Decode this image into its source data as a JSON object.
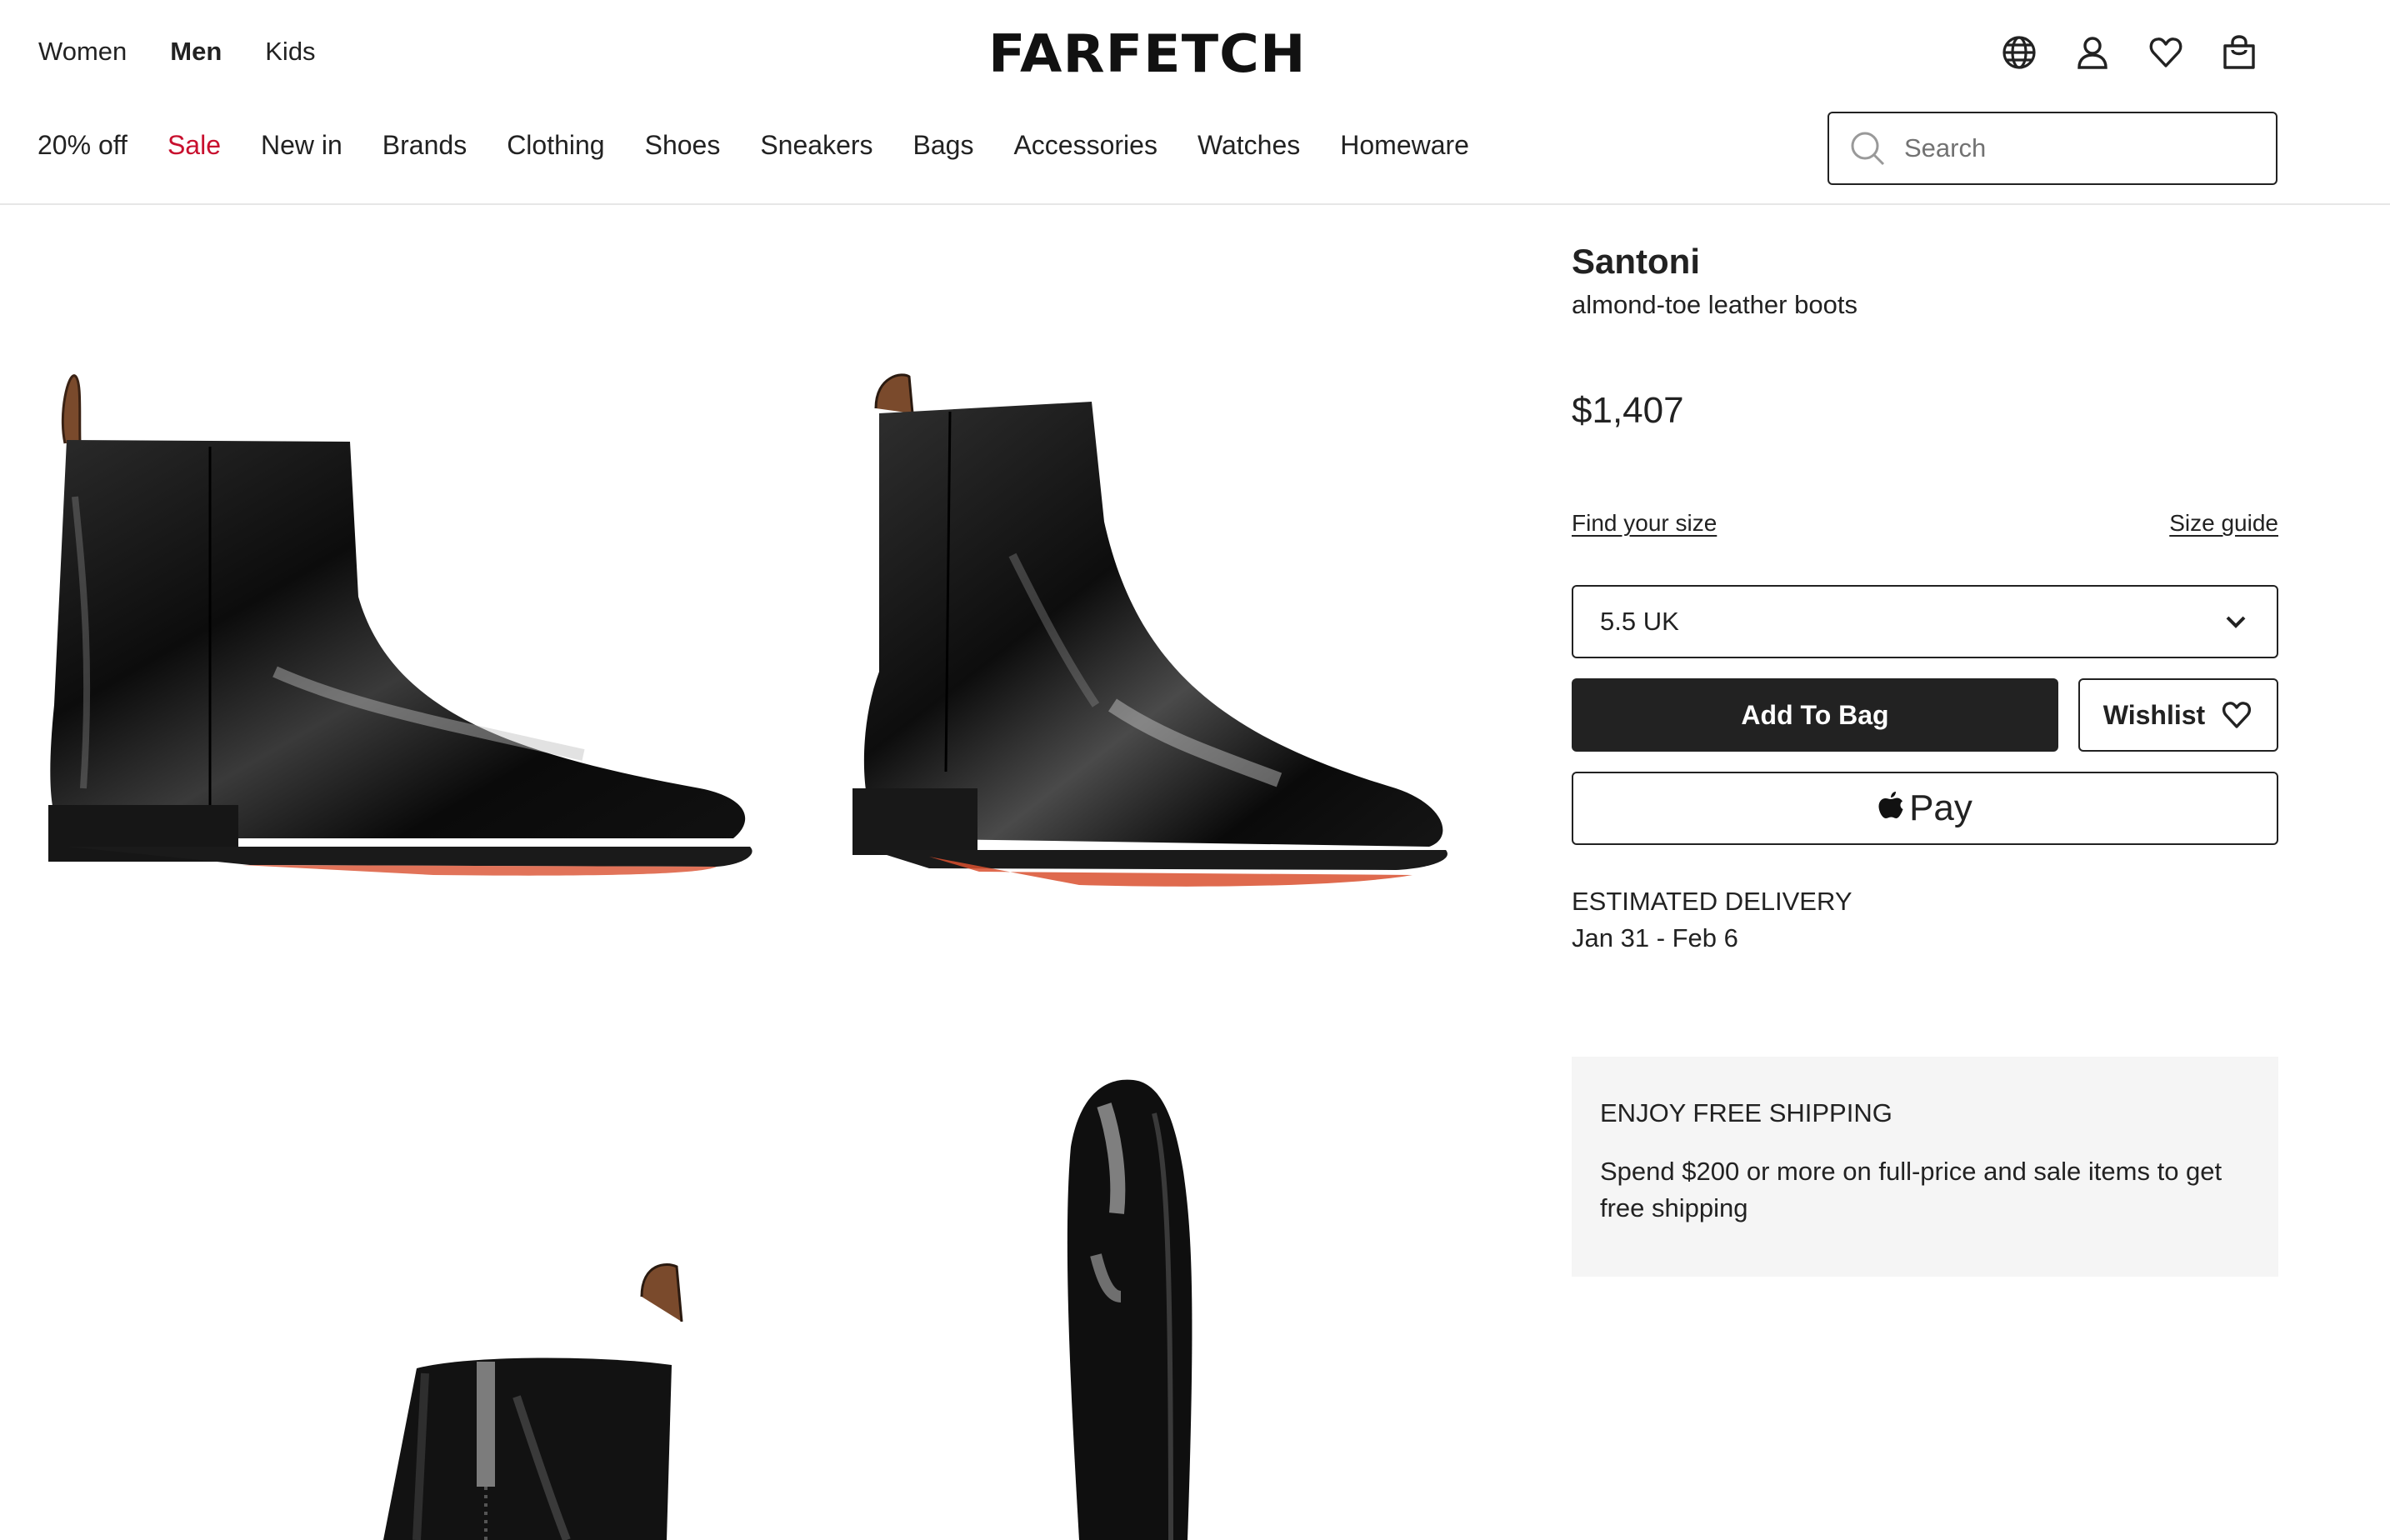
{
  "header": {
    "gender_tabs": [
      {
        "label": "Women",
        "active": false
      },
      {
        "label": "Men",
        "active": true
      },
      {
        "label": "Kids",
        "active": false
      }
    ],
    "logo": "FARFETCH",
    "icons": [
      "globe-icon",
      "account-icon",
      "wishlist-heart-icon",
      "shopping-bag-icon"
    ],
    "categories": [
      "20% off",
      "Sale",
      "New in",
      "Brands",
      "Clothing",
      "Shoes",
      "Sneakers",
      "Bags",
      "Accessories",
      "Watches",
      "Homeware"
    ],
    "sale_color": "#c8102e",
    "search": {
      "placeholder": "Search",
      "value": ""
    }
  },
  "gallery": {
    "images": [
      "boot-side-view",
      "boot-three-quarter-view",
      "boot-back-zip-view",
      "boot-top-view"
    ]
  },
  "product": {
    "brand": "Santoni",
    "name": "almond-toe leather boots",
    "price": "$1,407",
    "find_size": "Find your size",
    "size_guide": "Size guide",
    "selected_size": "5.5 UK",
    "add_to_bag": "Add To Bag",
    "wishlist": "Wishlist",
    "apple_pay": "Pay",
    "delivery_label": "ESTIMATED DELIVERY",
    "delivery_date": "Jan 31 - Feb 6",
    "promo_title": "ENJOY FREE SHIPPING",
    "promo_body": "Spend $200 or more on full-price and sale items to get free shipping"
  },
  "colors": {
    "text": "#222222",
    "button_dark": "#222222",
    "promo_bg": "#f5f5f5",
    "sole_accent": "#d9502f"
  }
}
